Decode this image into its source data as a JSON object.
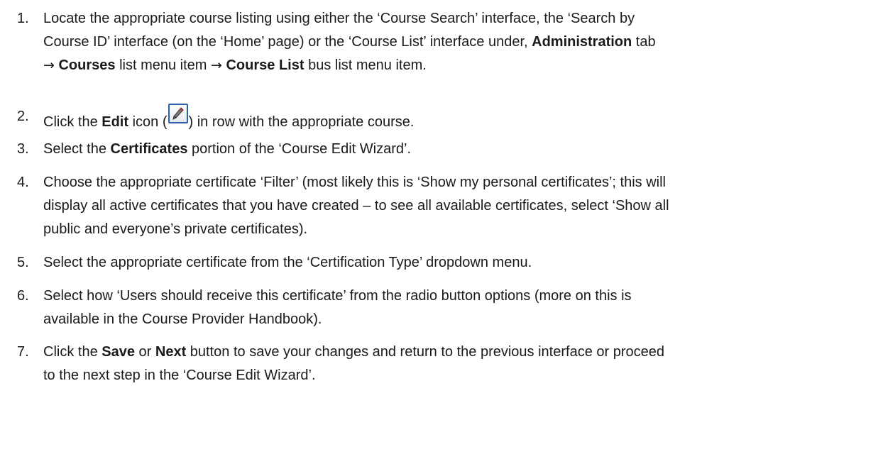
{
  "steps": [
    {
      "number": "1.",
      "line1": "Locate the appropriate course listing using either the ‘Course Search’ interface, the ‘Search by",
      "line2_a": "Course ID’ interface (on the ‘Home’ page) or the ‘Course List’ interface under, ",
      "line2_b": "Administration",
      "line2_c": " tab",
      "line3_arrow1": "→",
      "line3_b1": "Courses",
      "line3_a": " list menu item ",
      "line3_arrow2": "→",
      "line3_b2": "Course List",
      "line3_c": " bus list menu item."
    },
    {
      "number": "2.",
      "a": "Click the ",
      "b": "Edit",
      "c": " icon (",
      "icon": "pencil-edit-icon",
      "d": ") in row with the appropriate course."
    },
    {
      "number": "3.",
      "a": "Select the ",
      "b": "Certificates",
      "c": " portion of the ‘Course Edit Wizard’."
    },
    {
      "number": "4.",
      "line1": "Choose the appropriate certificate ‘Filter’ (most likely this is ‘Show my personal certificates’; this will",
      "line2": "display all active certificates that you have created – to see all available certificates, select ‘Show all",
      "line3": "public and everyone’s private certificates)."
    },
    {
      "number": "5.",
      "line1": "Select the appropriate certificate from the ‘Certification Type’ dropdown menu."
    },
    {
      "number": "6.",
      "line1": "Select how ‘Users should receive this certificate’ from the radio button options (more on this is",
      "line2": "available in the Course Provider Handbook)."
    },
    {
      "number": "7.",
      "a": "Click the ",
      "b1": "Save",
      "c": " or ",
      "b2": "Next",
      "d": " button to save your changes and return to the previous interface or proceed",
      "line2": "to the next step in the ‘Course Edit Wizard’."
    }
  ],
  "colors": {
    "text": "#1a1a1a",
    "icon_border": "#2d5fa8"
  }
}
